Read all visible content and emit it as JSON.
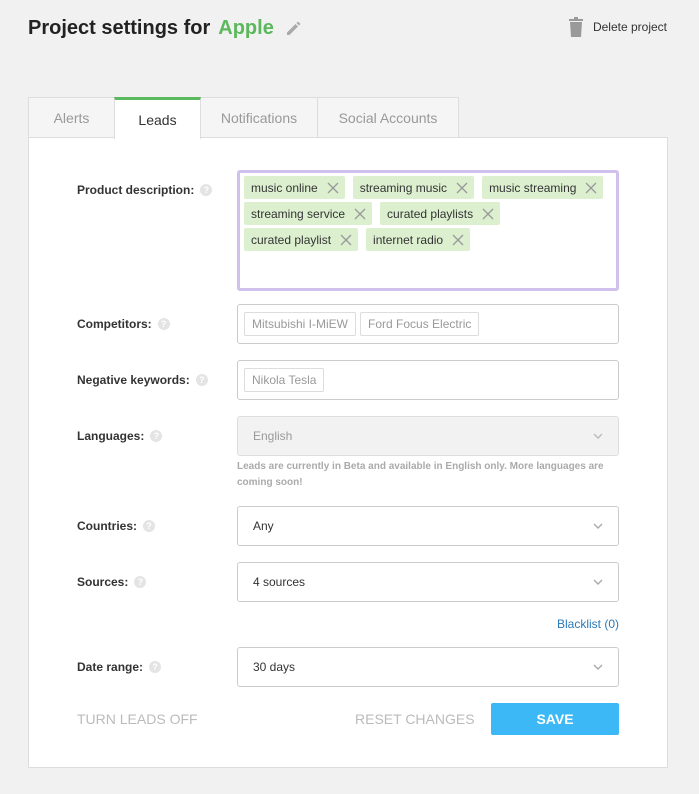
{
  "header": {
    "title": "Project settings for",
    "project_name": "Apple",
    "delete_label": "Delete project"
  },
  "tabs": [
    {
      "label": "Alerts",
      "active": false
    },
    {
      "label": "Leads",
      "active": true
    },
    {
      "label": "Notifications",
      "active": false
    },
    {
      "label": "Social Accounts",
      "active": false
    }
  ],
  "form": {
    "product_description": {
      "label": "Product description:",
      "tags": [
        "music online",
        "streaming music",
        "music streaming",
        "streaming service",
        "curated playlists",
        "curated playlist",
        "internet radio"
      ]
    },
    "competitors": {
      "label": "Competitors:",
      "chips": [
        "Mitsubishi I-MiEW",
        "Ford Focus Electric"
      ]
    },
    "negative_keywords": {
      "label": "Negative keywords:",
      "chips": [
        "Nikola Tesla"
      ]
    },
    "languages": {
      "label": "Languages:",
      "value": "English",
      "hint": "Leads are currently in Beta and available in English only. More languages are coming soon!"
    },
    "countries": {
      "label": "Countries:",
      "value": "Any"
    },
    "sources": {
      "label": "Sources:",
      "value": "4 sources"
    },
    "blacklist_label": "Blacklist (0)",
    "date_range": {
      "label": "Date range:",
      "value": "30 days"
    }
  },
  "footer": {
    "turn_off_label": "TURN LEADS OFF",
    "reset_label": "RESET CHANGES",
    "save_label": "SAVE"
  },
  "help_glyph": "?",
  "colors": {
    "accent_green": "#5cb85c",
    "save_blue": "#3bb8f5",
    "tag_bg": "#dcf0d0",
    "focus_border": "#cfc0ec",
    "link": "#2a7ab8"
  }
}
